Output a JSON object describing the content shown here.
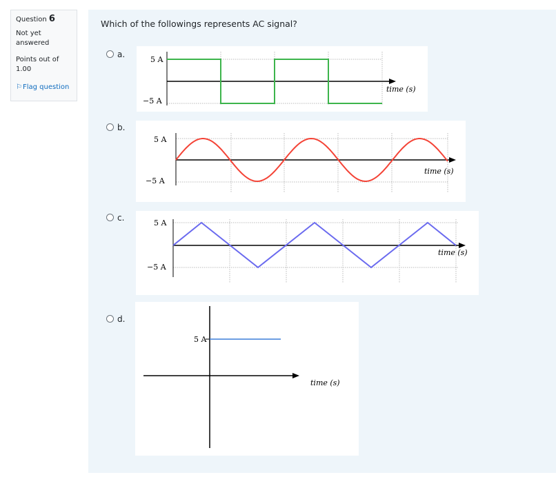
{
  "question": {
    "number_prefix": "Question",
    "number": "6",
    "state": "Not yet answered",
    "grade": "Points out of 1.00",
    "flag_label": "Flag question",
    "text": "Which of the followings represents AC signal?"
  },
  "options": [
    {
      "letter": "a.",
      "plot": {
        "top_label": "5 A",
        "bottom_label": "−5 A",
        "axis_label": "time (s)",
        "color": "#3cb44b",
        "shape": "square"
      }
    },
    {
      "letter": "b.",
      "plot": {
        "top_label": "5 A",
        "bottom_label": "−5 A",
        "axis_label": "time (s)",
        "color": "#f44336",
        "shape": "sine"
      }
    },
    {
      "letter": "c.",
      "plot": {
        "top_label": "5 A",
        "bottom_label": "−5 A",
        "axis_label": "time (s)",
        "color": "#6a6aef",
        "shape": "triangle"
      }
    },
    {
      "letter": "d.",
      "plot": {
        "top_label": "5 A",
        "axis_label": "time (s)",
        "color": "#3b7dd8",
        "shape": "dc"
      }
    }
  ],
  "colors": {
    "panel_bg": "#eef5fa",
    "link": "#0f6cbf"
  }
}
